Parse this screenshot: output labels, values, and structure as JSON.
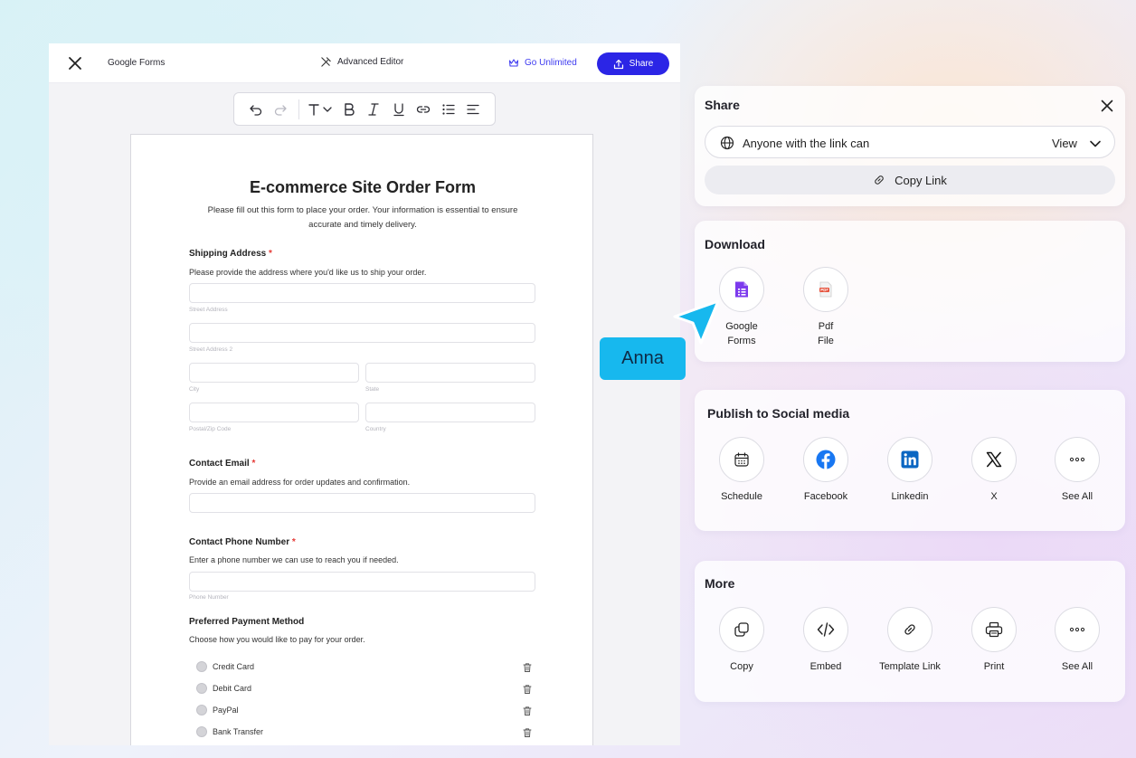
{
  "editor": {
    "app_name": "Google Forms",
    "advanced_editor_label": "Advanced Editor",
    "go_unlimited_label": "Go Unlimited",
    "share_label": "Share"
  },
  "toolbar": {
    "icons": [
      "undo-icon",
      "redo-icon",
      "text-style-icon",
      "bold-icon",
      "italic-icon",
      "underline-icon",
      "link-icon",
      "bullet-list-icon",
      "align-left-icon"
    ]
  },
  "form": {
    "title": "E-commerce Site Order Form",
    "description": "Please fill out this form to place your order. Your information is essential to ensure accurate and timely delivery.",
    "shipping": {
      "title": "Shipping Address",
      "required_mark": "*",
      "description": "Please provide the address where you'd like us to ship your order.",
      "street": "Street Address",
      "street2": "Street Address 2",
      "city": "City",
      "state": "State",
      "zip": "Postal/Zip Code",
      "country": "Country"
    },
    "email": {
      "title": "Contact Email",
      "required_mark": "*",
      "description": "Provide an email address for order updates and confirmation."
    },
    "phone": {
      "title": "Contact Phone Number",
      "required_mark": "*",
      "description": "Enter a phone number we can use to reach you if needed.",
      "sub": "Phone Number"
    },
    "payment": {
      "title": "Preferred Payment Method",
      "description": "Choose how you would like to pay for your order.",
      "options": [
        "Credit Card",
        "Debit Card",
        "PayPal",
        "Bank Transfer"
      ]
    }
  },
  "share_panel": {
    "title": "Share",
    "access_text": "Anyone with the link can",
    "permission": "View",
    "copy_link_label": "Copy Link"
  },
  "download_panel": {
    "title": "Download",
    "items": [
      {
        "label": "Google\nForms",
        "icon": "google-forms-icon"
      },
      {
        "label": "Pdf\nFile",
        "icon": "pdf-file-icon"
      }
    ]
  },
  "social_panel": {
    "title": "Publish to Social media",
    "items": [
      {
        "label": "Schedule",
        "icon": "calendar-icon"
      },
      {
        "label": "Facebook",
        "icon": "facebook-icon"
      },
      {
        "label": "Linkedin",
        "icon": "linkedin-icon"
      },
      {
        "label": "X",
        "icon": "x-logo-icon"
      },
      {
        "label": "See All",
        "icon": "more-icon"
      }
    ]
  },
  "more_panel": {
    "title": "More",
    "items": [
      {
        "label": "Copy",
        "icon": "copy-icon"
      },
      {
        "label": "Embed",
        "icon": "code-icon"
      },
      {
        "label": "Template Link",
        "icon": "link-icon"
      },
      {
        "label": "Print",
        "icon": "printer-icon"
      },
      {
        "label": "See All",
        "icon": "more-icon"
      }
    ]
  },
  "cursor": {
    "name": "Anna",
    "color": "#17b8ee"
  },
  "colors": {
    "accent": "#2b25e6",
    "required": "#e53935",
    "facebook": "#1877f2",
    "linkedin": "#0a66c2",
    "google_forms": "#7c3aed",
    "pdf": "#e5533d"
  }
}
